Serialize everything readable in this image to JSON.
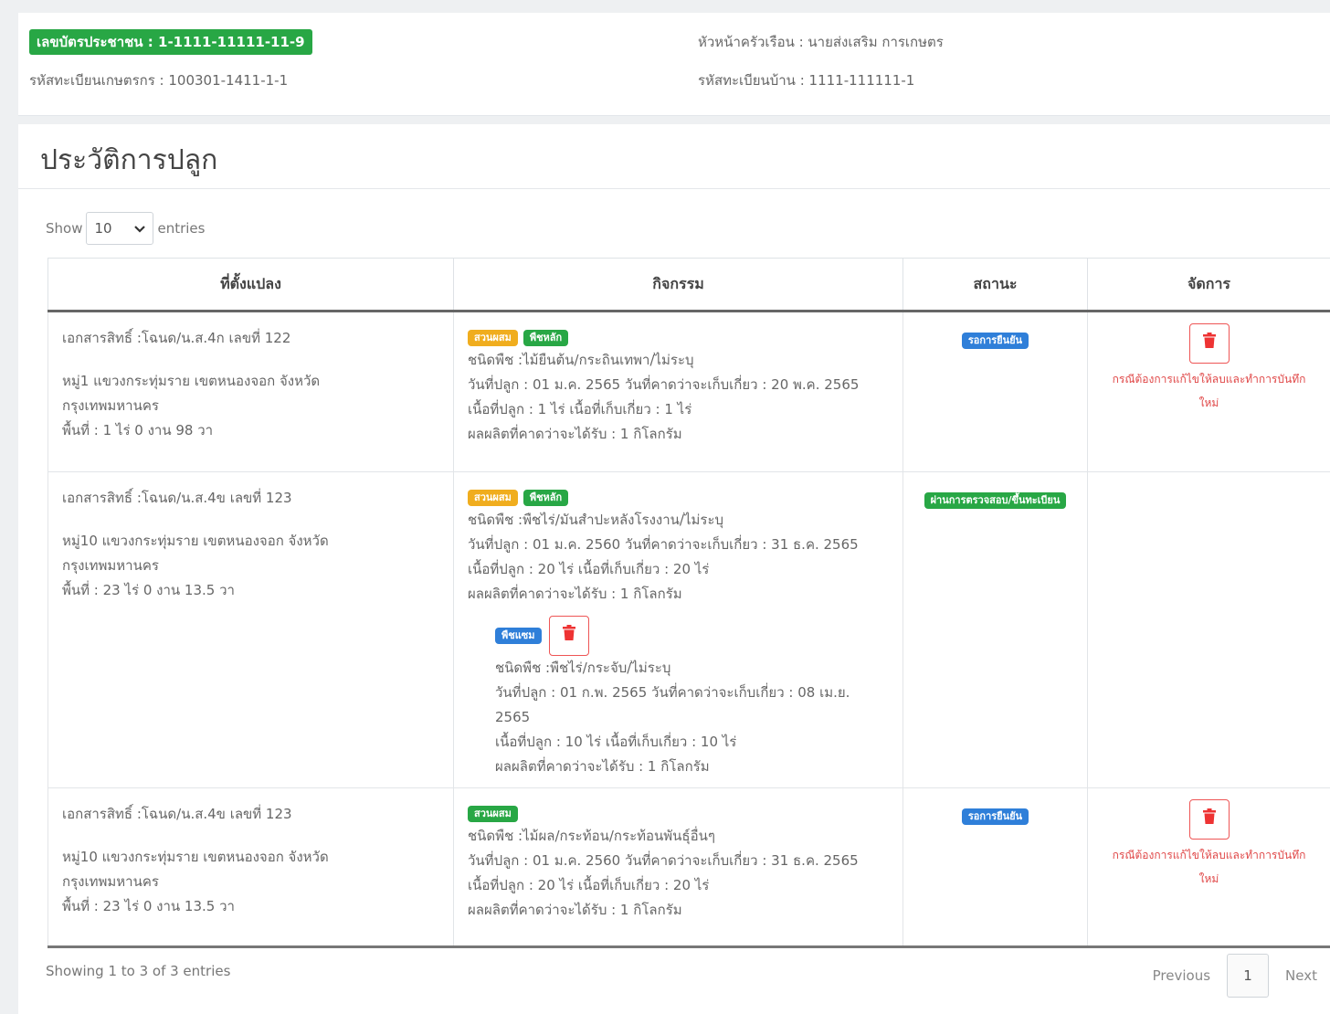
{
  "info": {
    "citizen_id": "เลขบัตรประชาชน : 1-1111-11111-11-9",
    "farmer_reg": "รหัสทะเบียนเกษตรกร : 100301-1411-1-1",
    "household_head": "หัวหน้าครัวเรือน : นายส่งเสริม การเกษตร",
    "house_reg": "รหัสทะเบียนบ้าน : 1111-111111-1"
  },
  "title": "ประวัติการปลูก",
  "length": {
    "show": "Show",
    "value": "10",
    "entries": "entries"
  },
  "columns": [
    "ที่ตั้งแปลง",
    "กิจกรรม",
    "สถานะ",
    "จัดการ"
  ],
  "rows": [
    {
      "doc": "เอกสารสิทธิ์ :โฉนด/น.ส.4ก เลขที่ 122",
      "address1": "หมู่1 แขวงกระทุ่มราย เขตหนองจอก จังหวัด",
      "address2": "กรุงเทพมหานคร",
      "area": "พื้นที่ : 1 ไร่ 0 งาน 98 วา",
      "tags": [
        "สวนผสม",
        "พืชหลัก"
      ],
      "crop": "ชนิดพืช :ไม้ยืนต้น/กระถินเทพา/ไม่ระบุ",
      "dates": "วันที่ปลูก : 01 ม.ค. 2565 วันที่คาดว่าจะเก็บเกี่ยว : 20 พ.ค. 2565",
      "areas": "เนื้อที่ปลูก : 1 ไร่ เนื้อที่เก็บเกี่ยว : 1 ไร่",
      "yield": "ผลผลิตที่คาดว่าจะได้รับ : 1 กิโลกรัม",
      "status": "รอการยืนยัน",
      "note1": "กรณีต้องการแก้ไขให้ลบและทำการบันทึก",
      "note2": "ใหม่"
    },
    {
      "doc": "เอกสารสิทธิ์ :โฉนด/น.ส.4ข เลขที่ 123",
      "address1": "หมู่10 แขวงกระทุ่มราย เขตหนองจอก จังหวัด",
      "address2": "กรุงเทพมหานคร",
      "area": "พื้นที่ : 23 ไร่ 0 งาน 13.5 วา",
      "tags": [
        "สวนผสม",
        "พืชหลัก"
      ],
      "crop": "ชนิดพืช :พืชไร่/มันสำปะหลังโรงงาน/ไม่ระบุ",
      "dates": "วันที่ปลูก : 01 ม.ค. 2560 วันที่คาดว่าจะเก็บเกี่ยว : 31 ธ.ค. 2565",
      "areas": "เนื้อที่ปลูก : 20 ไร่ เนื้อที่เก็บเกี่ยว : 20 ไร่",
      "yield": "ผลผลิตที่คาดว่าจะได้รับ : 1 กิโลกรัม",
      "sub": {
        "tag": "พืชแซม",
        "crop": "ชนิดพืช :พืชไร่/กระจับ/ไม่ระบุ",
        "dates1": "วันที่ปลูก : 01 ก.พ. 2565 วันที่คาดว่าจะเก็บเกี่ยว : 08 เม.ย.",
        "dates2": "2565",
        "areas": "เนื้อที่ปลูก : 10 ไร่ เนื้อที่เก็บเกี่ยว : 10 ไร่",
        "yield": "ผลผลิตที่คาดว่าจะได้รับ : 1 กิโลกรัม"
      },
      "status": "ผ่านการตรวจสอบ/ขึ้นทะเบียน"
    },
    {
      "doc": "เอกสารสิทธิ์ :โฉนด/น.ส.4ข เลขที่ 123",
      "address1": "หมู่10 แขวงกระทุ่มราย เขตหนองจอก จังหวัด",
      "address2": "กรุงเทพมหานคร",
      "area": "พื้นที่ : 23 ไร่ 0 งาน 13.5 วา",
      "tags": [
        "สวนผสม"
      ],
      "crop": "ชนิดพืช :ไม้ผล/กระท้อน/กระท้อนพันธุ์อื่นๆ",
      "dates": "วันที่ปลูก : 01 ม.ค. 2560 วันที่คาดว่าจะเก็บเกี่ยว : 31 ธ.ค. 2565",
      "areas": "เนื้อที่ปลูก : 20 ไร่ เนื้อที่เก็บเกี่ยว : 20 ไร่",
      "yield": "ผลผลิตที่คาดว่าจะได้รับ : 1 กิโลกรัม",
      "status": "รอการยืนยัน",
      "note1": "กรณีต้องการแก้ไขให้ลบและทำการบันทึก",
      "note2": "ใหม่"
    }
  ],
  "footer": {
    "info": "Showing 1 to 3 of 3 entries",
    "previous": "Previous",
    "page": "1",
    "next": "Next"
  }
}
